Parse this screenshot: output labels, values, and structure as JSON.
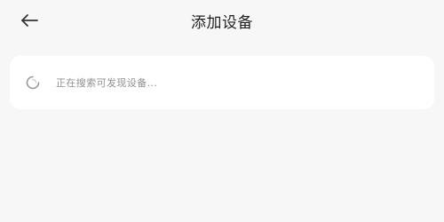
{
  "header": {
    "title": "添加设备",
    "back_icon": "arrow-left-icon"
  },
  "search_card": {
    "status_text": "正在搜索可发现设备...",
    "spinner_icon": "loading-spinner-icon"
  },
  "colors": {
    "background": "#f7f7f7",
    "card": "#ffffff",
    "title_text": "#1f1f1f",
    "status_text": "#8f8f8f",
    "spinner": "#9a9a9a"
  }
}
